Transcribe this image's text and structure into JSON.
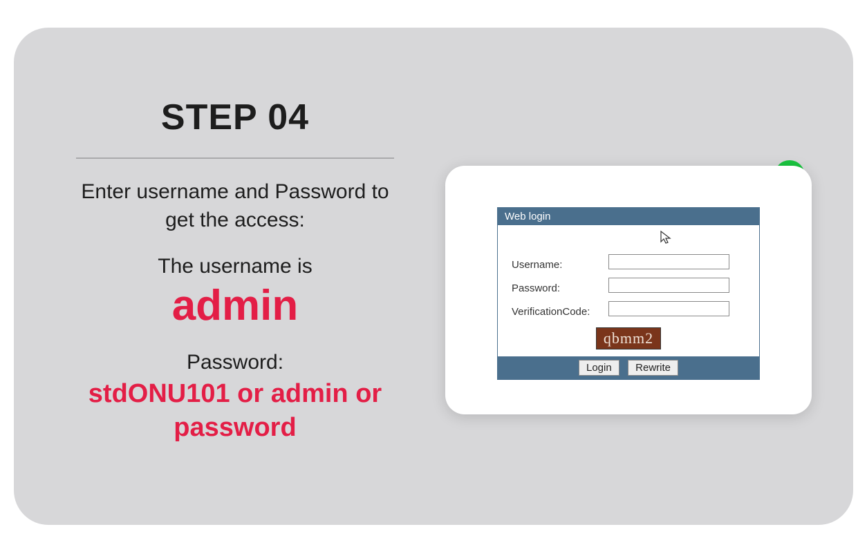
{
  "left": {
    "step_title": "STEP 04",
    "instruction": "Enter username and Pass­word to get the access:",
    "username_label": "The username is",
    "username_value": "admin",
    "password_label": "Password:",
    "password_options": "stdONU101 or admin or password"
  },
  "login_panel": {
    "title": "Web login",
    "username_label": "Username:",
    "password_label": "Password:",
    "verification_label": "VerificationCode:",
    "captcha_text": "qbmm2",
    "login_button": "Login",
    "rewrite_button": "Rewrite"
  }
}
